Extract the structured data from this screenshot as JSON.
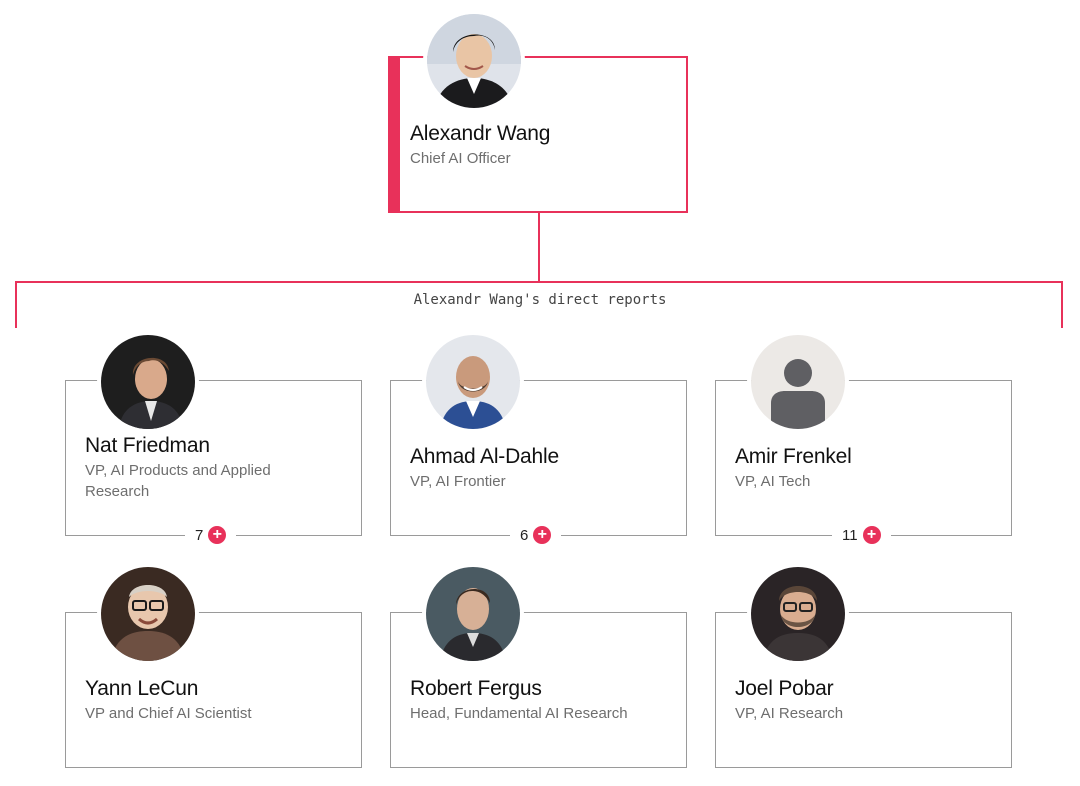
{
  "accent_color": "#e8315a",
  "root": {
    "name": "Alexandr Wang",
    "title": "Chief AI Officer",
    "avatar_icon": "person-photo-icon"
  },
  "reports_caption": "Alexandr Wang's direct reports",
  "reports": [
    {
      "name": "Nat Friedman",
      "title": "VP, AI Products and Applied Research",
      "count": "7",
      "avatar_icon": "person-photo-icon"
    },
    {
      "name": "Ahmad Al-Dahle",
      "title": "VP, AI Frontier",
      "count": "6",
      "avatar_icon": "person-photo-icon"
    },
    {
      "name": "Amir Frenkel",
      "title": "VP, AI Tech",
      "count": "11",
      "avatar_icon": "default-user-icon"
    },
    {
      "name": "Yann LeCun",
      "title": "VP and Chief AI Scientist",
      "avatar_icon": "person-photo-icon"
    },
    {
      "name": "Robert Fergus",
      "title": "Head, Fundamental AI Research",
      "avatar_icon": "person-photo-icon"
    },
    {
      "name": "Joel Pobar",
      "title": "VP, AI Research",
      "avatar_icon": "person-photo-icon"
    }
  ]
}
